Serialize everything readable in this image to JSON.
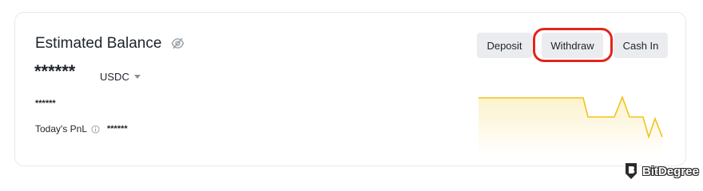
{
  "balance": {
    "title": "Estimated Balance",
    "masked_value": "******",
    "currency": "USDC",
    "masked_secondary": "******"
  },
  "pnl": {
    "label": "Today's PnL",
    "masked_value": "******"
  },
  "actions": {
    "deposit": "Deposit",
    "withdraw": "Withdraw",
    "cash_in": "Cash In"
  },
  "icons": {
    "hide": "eye-slash-icon",
    "info": "info-icon",
    "dropdown": "caret-down-icon"
  },
  "colors": {
    "accent_highlight": "#e3241b",
    "sparkline": "#f0c419",
    "button_bg": "#eaecef"
  },
  "watermark": {
    "text": "BitDegree"
  }
}
